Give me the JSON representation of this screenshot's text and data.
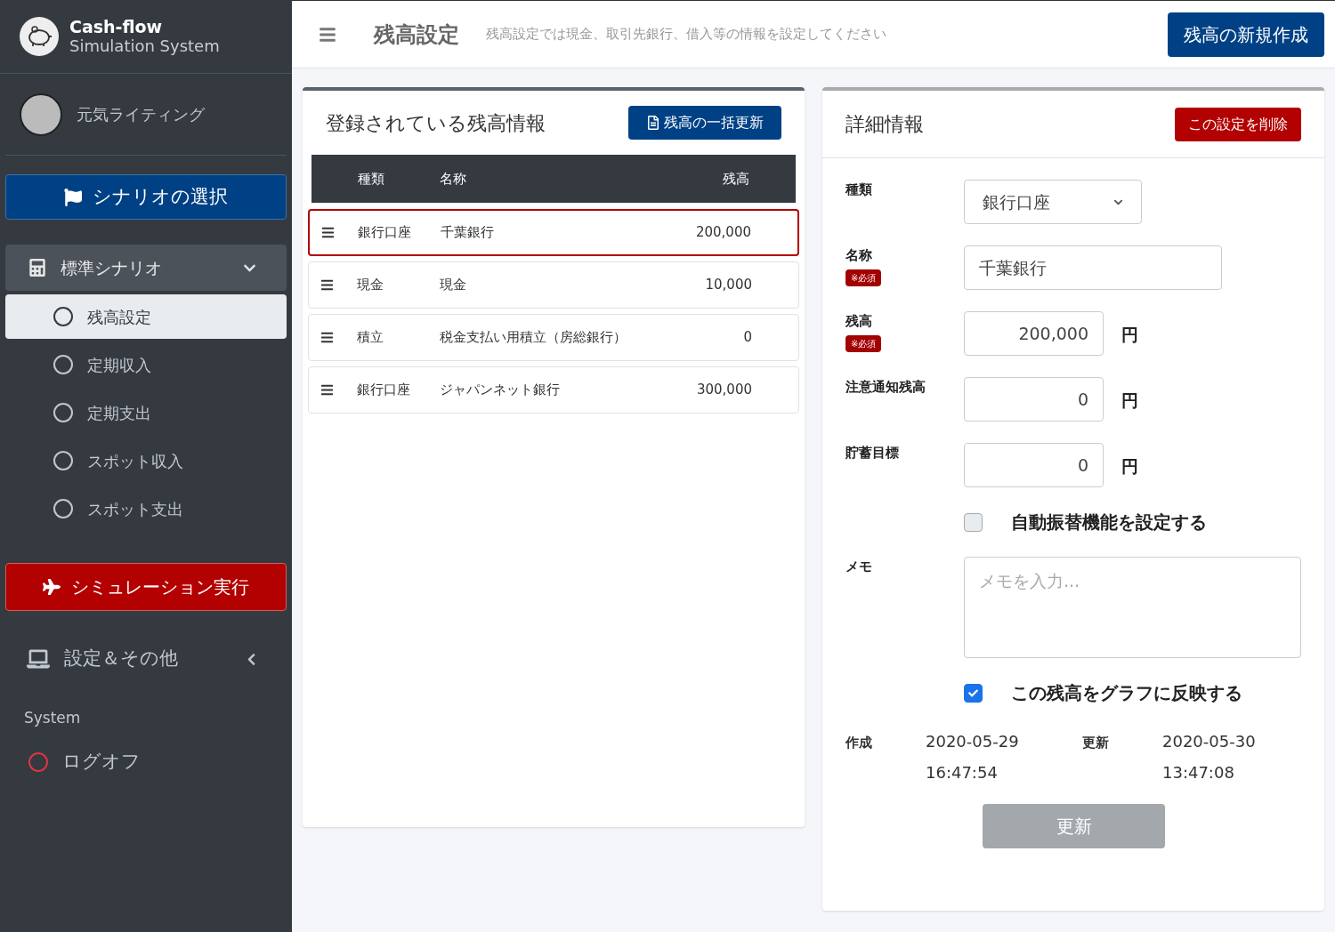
{
  "brand": {
    "title": "Cash-flow",
    "subtitle": "Simulation System"
  },
  "user": {
    "name": "元気ライティング"
  },
  "scenario_button": "シナリオの選択",
  "scenario": {
    "label": "標準シナリオ",
    "expanded": true,
    "items": [
      {
        "label": "残高設定",
        "selected": true
      },
      {
        "label": "定期収入",
        "selected": false
      },
      {
        "label": "定期支出",
        "selected": false
      },
      {
        "label": "スポット収入",
        "selected": false
      },
      {
        "label": "スポット支出",
        "selected": false
      }
    ]
  },
  "run_button": "シミュレーション実行",
  "settings": {
    "label": "設定＆その他",
    "expanded": false
  },
  "system_heading": "System",
  "logoff": "ログオフ",
  "header": {
    "title": "残高設定",
    "description": "残高設定では現金、取引先銀行、借入等の情報を設定してください",
    "new_button": "残高の新規作成"
  },
  "list_card": {
    "title": "登録されている残高情報",
    "bulk_button": "残高の一括更新",
    "columns": [
      "種類",
      "名称",
      "残高"
    ],
    "rows": [
      {
        "type": "銀行口座",
        "name": "千葉銀行",
        "balance": "200,000",
        "selected": true
      },
      {
        "type": "現金",
        "name": "現金",
        "balance": "10,000",
        "selected": false
      },
      {
        "type": "積立",
        "name": "税金支払い用積立（房総銀行）",
        "balance": "0",
        "selected": false
      },
      {
        "type": "銀行口座",
        "name": "ジャパンネット銀行",
        "balance": "300,000",
        "selected": false
      }
    ]
  },
  "detail_card": {
    "title": "詳細情報",
    "delete_button": "この設定を削除",
    "fields": [
      {
        "kind": "select",
        "label": "種類",
        "value": "銀行口座"
      },
      {
        "kind": "text",
        "label": "名称",
        "value": "千葉銀行",
        "required": "※必須"
      },
      {
        "kind": "amount",
        "label": "残高",
        "value": "200,000",
        "required": "※必須",
        "unit": "円"
      },
      {
        "kind": "amount",
        "label": "注意通知残高",
        "value": "0",
        "unit": "円"
      },
      {
        "kind": "amount",
        "label": "貯蓄目標",
        "value": "0",
        "unit": "円"
      },
      {
        "kind": "checkbox",
        "label": "自動振替機能を設定する",
        "checked": false
      },
      {
        "kind": "textarea",
        "label": "メモ",
        "placeholder": "メモを入力..."
      },
      {
        "kind": "checkbox",
        "label": "この残高をグラフに反映する",
        "checked": true
      }
    ],
    "created_label": "作成",
    "created_date": "2020-05-29",
    "created_time": "16:47:54",
    "updated_label": "更新",
    "updated_date": "2020-05-30",
    "updated_time": "13:47:08",
    "update_button": "更新"
  }
}
